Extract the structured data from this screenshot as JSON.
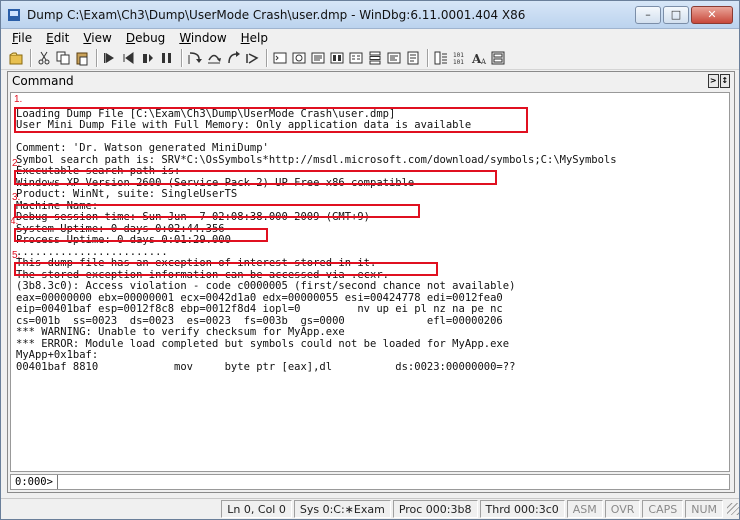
{
  "window": {
    "title": "Dump C:\\Exam\\Ch3\\Dump\\UserMode Crash\\user.dmp - WinDbg:6.11.0001.404 X86",
    "minimize": "–",
    "maximize": "□",
    "close": "✕"
  },
  "menu": [
    {
      "label": "File",
      "key": "F",
      "rest": "ile"
    },
    {
      "label": "Edit",
      "key": "E",
      "rest": "dit"
    },
    {
      "label": "View",
      "key": "V",
      "rest": "iew"
    },
    {
      "label": "Debug",
      "key": "D",
      "rest": "ebug"
    },
    {
      "label": "Window",
      "key": "W",
      "rest": "indow"
    },
    {
      "label": "Help",
      "key": "H",
      "rest": "elp"
    }
  ],
  "toolbar": [
    "open-icon",
    "cut-icon",
    "copy-icon",
    "paste-icon",
    "go-icon",
    "restart-icon",
    "stop-icon",
    "break-icon",
    "step-into-icon",
    "step-over-icon",
    "step-out-icon",
    "run-to-cursor-icon",
    "command-window-icon",
    "watch-icon",
    "locals-icon",
    "registers-icon",
    "memory-icon",
    "call-stack-icon",
    "disassembly-icon",
    "scratch-pad-icon",
    "source-mode-icon",
    "hex-mode-icon",
    "font-icon",
    "options-icon"
  ],
  "command_panel": {
    "title": "Command",
    "lines": [
      "",
      "Loading Dump File [C:\\Exam\\Ch3\\Dump\\UserMode Crash\\user.dmp]",
      "User Mini Dump File with Full Memory: Only application data is available",
      "",
      "Comment: 'Dr. Watson generated MiniDump'",
      "Symbol search path is: SRV*C:\\OsSymbols*http://msdl.microsoft.com/download/symbols;C:\\MySymbols",
      "Executable search path is:",
      "Windows XP Version 2600 (Service Pack 2) UP Free x86 compatible",
      "Product: WinNt, suite: SingleUserTS",
      "Machine Name:",
      "Debug session time: Sun Jun  7 02:08:38.000 2009 (GMT+9)",
      "System Uptime: 0 days 0:02:44.356",
      "Process Uptime: 0 days 0:01:29.000",
      "........................",
      "This dump file has an exception of interest stored in it.",
      "The stored exception information can be accessed via .ecxr.",
      "(3b8.3c0): Access violation - code c0000005 (first/second chance not available)",
      "eax=00000000 ebx=00000001 ecx=0042d1a0 edx=00000055 esi=00424778 edi=0012fea0",
      "eip=00401baf esp=0012f8c8 ebp=0012f8d4 iopl=0         nv up ei pl nz na pe nc",
      "cs=001b  ss=0023  ds=0023  es=0023  fs=003b  gs=0000             efl=00000206",
      "*** WARNING: Unable to verify checksum for MyApp.exe",
      "*** ERROR: Module load completed but symbols could not be loaded for MyApp.exe",
      "MyApp+0x1baf:",
      "00401baf 8810            mov     byte ptr [eax],dl          ds:0023:00000000=??"
    ],
    "annotations": [
      "1.",
      "2.",
      "3.",
      "4.",
      "5."
    ],
    "prompt": "0:000>",
    "input_value": ""
  },
  "status": {
    "ln_col": "Ln 0, Col 0",
    "sys": "Sys 0:C:∗Exam",
    "proc": "Proc 000:3b8",
    "thrd": "Thrd 000:3c0",
    "asm": "ASM",
    "ovr": "OVR",
    "caps": "CAPS",
    "num": "NUM"
  }
}
